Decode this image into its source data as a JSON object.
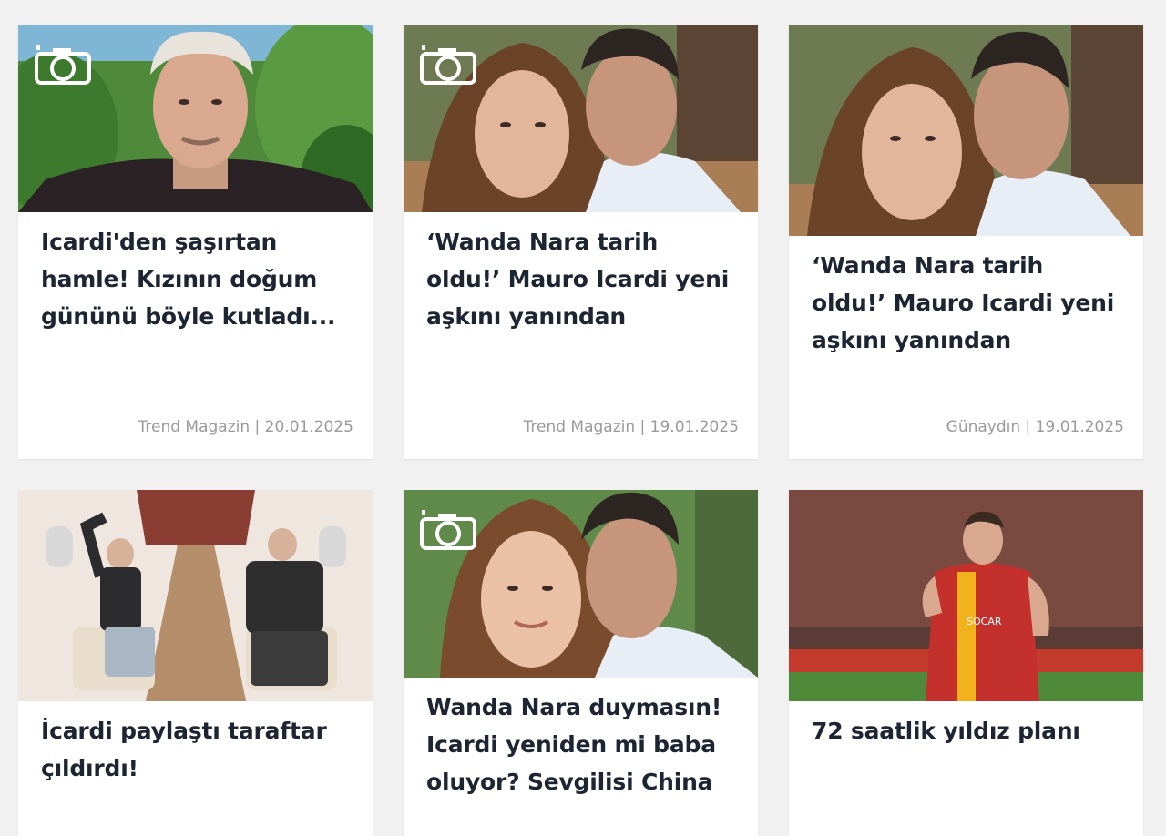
{
  "colors": {
    "background": "#f1f1f1",
    "card": "#ffffff",
    "title": "#1d2533",
    "meta": "#9a9a9a"
  },
  "cards": [
    {
      "title": "Icardi'den şaşırtan hamle! Kızının doğum gününü böyle kutladı...",
      "source": "Trend Magazin",
      "date": "20.01.2025",
      "meta": "Trend Magazin | 20.01.2025",
      "icon": "gallery-camera-icon",
      "image": "Icardi selfie with tropical plants"
    },
    {
      "title": "‘Wanda Nara tarih oldu!’ Mauro Icardi yeni aşkını yanından",
      "source": "Trend Magazin",
      "date": "19.01.2025",
      "meta": "Trend Magazin | 19.01.2025",
      "icon": "gallery-camera-icon",
      "image": "Icardi with girlfriend outdoors"
    },
    {
      "title": "‘Wanda Nara tarih oldu!’ Mauro Icardi yeni aşkını yanından",
      "source": "Günaydın",
      "date": "19.01.2025",
      "meta": "Günaydın | 19.01.2025",
      "icon": "",
      "image": "Icardi with girlfriend outdoors"
    },
    {
      "title": "İcardi paylaştı taraftar çıldırdı!",
      "source": "",
      "date": "",
      "meta": "",
      "icon": "",
      "image": "Couple seated in private jet cabin"
    },
    {
      "title": "Wanda Nara duymasın! Icardi yeniden mi baba oluyor? Sevgilisi China",
      "source": "",
      "date": "",
      "meta": "",
      "icon": "gallery-camera-icon",
      "image": "Icardi with girlfriend close-up"
    },
    {
      "title": "72 saatlik yıldız planı",
      "source": "",
      "date": "",
      "meta": "",
      "icon": "",
      "image": "Footballer in red-yellow kit celebrating at stadium"
    }
  ]
}
